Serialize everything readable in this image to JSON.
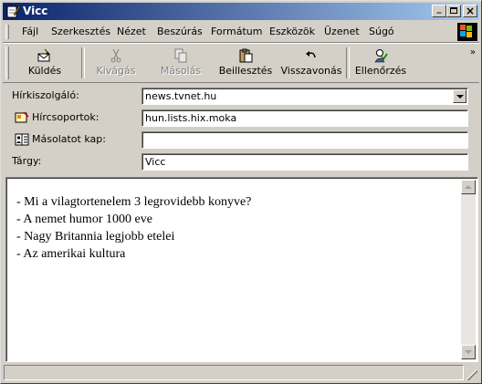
{
  "window": {
    "title": "Vicc",
    "controls": {
      "minimize": "_",
      "maximize": "□",
      "close": "×"
    }
  },
  "menu": [
    "Fájl",
    "Szerkesztés",
    "Nézet",
    "Beszúrás",
    "Formátum",
    "Eszközök",
    "Üzenet",
    "Súgó"
  ],
  "toolbar": {
    "send": "Küldés",
    "cut": "Kivágás",
    "copy": "Másolás",
    "paste": "Beillesztés",
    "undo": "Visszavonás",
    "check": "Ellenőrzés",
    "more": "»"
  },
  "fields": {
    "server_label": "Hírkiszolgáló:",
    "server_value": "news.tvnet.hu",
    "newsgroups_label": "Hírcsoportok:",
    "newsgroups_value": "hun.lists.hix.moka",
    "cc_label": "Másolatot kap:",
    "cc_value": "",
    "subject_label": "Tárgy:",
    "subject_value": "Vicc"
  },
  "message_lines": [
    "- Mi a vilagtortenelem 3 legrovidebb konyve?",
    "- A nemet humor 1000 eve",
    "- Nagy Britannia legjobb etelei",
    "- Az amerikai kultura"
  ],
  "icons": {
    "title": "compose-note-icon",
    "send": "send-envelope-icon",
    "cut": "scissors-icon",
    "copy": "copy-icon",
    "paste": "clipboard-icon",
    "undo": "undo-arrow-icon",
    "check": "spellcheck-icon",
    "newsgroups": "newsgroup-card-icon",
    "cc": "address-book-icon"
  },
  "colors": {
    "titlebar_start": "#0a246a",
    "titlebar_end": "#a6caf0",
    "face": "#d4d0c8"
  }
}
